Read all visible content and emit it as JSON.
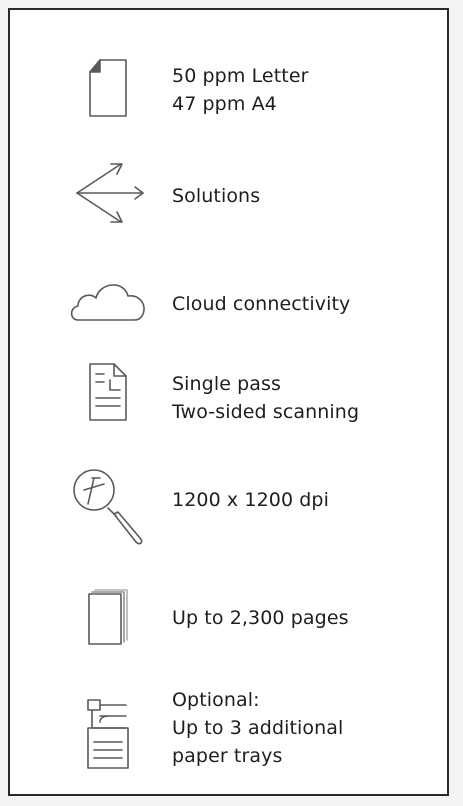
{
  "features": [
    {
      "icon": "page-icon",
      "lines": [
        "50 ppm Letter",
        "47 ppm A4"
      ]
    },
    {
      "icon": "share-arrows-icon",
      "lines": [
        "Solutions"
      ]
    },
    {
      "icon": "cloud-icon",
      "lines": [
        "Cloud connectivity"
      ]
    },
    {
      "icon": "scanned-document-icon",
      "lines": [
        "Single pass",
        "Two-sided scanning"
      ]
    },
    {
      "icon": "magnifier-icon",
      "lines": [
        "1200 x 1200 dpi"
      ]
    },
    {
      "icon": "paper-stack-icon",
      "lines": [
        "Up to 2,300 pages"
      ]
    },
    {
      "icon": "printer-trays-icon",
      "lines": [
        "Optional:",
        "Up to 3 additional",
        "paper trays"
      ]
    }
  ]
}
